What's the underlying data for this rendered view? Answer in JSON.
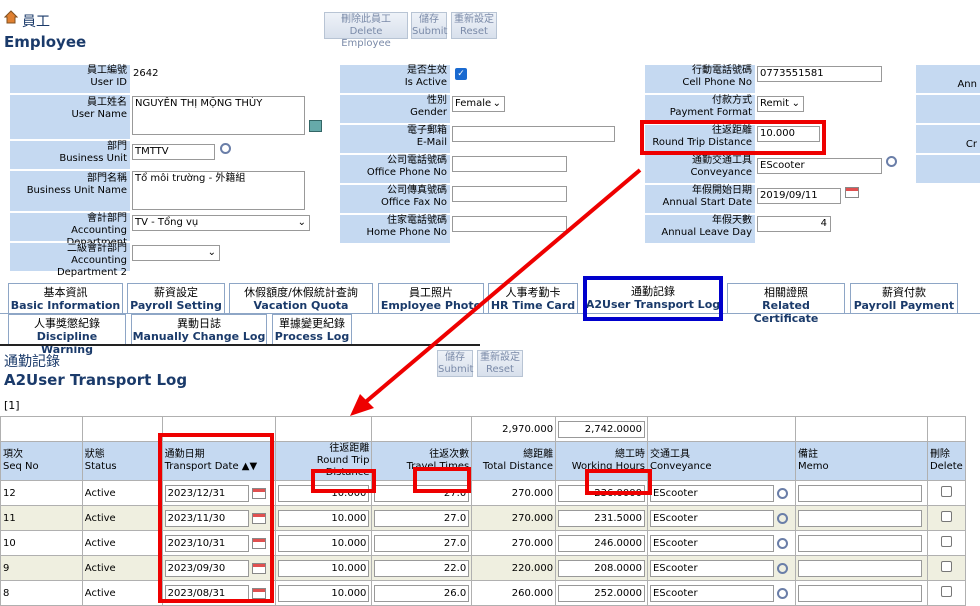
{
  "header": {
    "title_zh": "員工",
    "title_en": "Employee"
  },
  "toolbar": {
    "delete_zh": "刪除此員工",
    "delete_en": "Delete Employee",
    "save_zh": "儲存",
    "save_en": "Submit",
    "reset_zh": "重新設定",
    "reset_en": "Reset"
  },
  "form": {
    "user_id": {
      "zh": "員工編號",
      "en": "User ID",
      "value": "2642"
    },
    "user_name": {
      "zh": "員工姓名",
      "en": "User Name",
      "value": "NGUYỄN THỊ MỘNG THÙY"
    },
    "business_unit": {
      "zh": "部門",
      "en": "Business Unit",
      "value": "TMTTV"
    },
    "business_unit_name": {
      "zh": "部門名稱",
      "en": "Business Unit Name",
      "value": "Tổ môi trường - 外籍組"
    },
    "accounting_dept": {
      "zh": "會計部門",
      "en": "Accounting Department",
      "value": "TV - Tổng vụ"
    },
    "accounting_dept2": {
      "zh": "二級會計部門",
      "en": "Accounting Department 2",
      "value": ""
    },
    "is_active": {
      "zh": "是否生效",
      "en": "Is Active"
    },
    "gender": {
      "zh": "性別",
      "en": "Gender",
      "value": "Female"
    },
    "email": {
      "zh": "電子郵箱",
      "en": "E-Mail",
      "value": ""
    },
    "office_phone": {
      "zh": "公司電話號碼",
      "en": "Office Phone No",
      "value": ""
    },
    "office_fax": {
      "zh": "公司傳真號碼",
      "en": "Office Fax No",
      "value": ""
    },
    "home_phone": {
      "zh": "住家電話號碼",
      "en": "Home Phone No",
      "value": ""
    },
    "cell_phone": {
      "zh": "行動電話號碼",
      "en": "Cell Phone No",
      "value": "0773551581"
    },
    "payment_format": {
      "zh": "付款方式",
      "en": "Payment Format",
      "value": "Remit"
    },
    "round_trip": {
      "zh": "往返距離",
      "en": "Round Trip Distance",
      "value": "10.000"
    },
    "conveyance": {
      "zh": "通勤交通工具",
      "en": "Conveyance",
      "value": "EScooter"
    },
    "annual_start": {
      "zh": "年假開始日期",
      "en": "Annual Start Date",
      "value": "2019/09/11"
    },
    "annual_days": {
      "zh": "年假天數",
      "en": "Annual Leave Day",
      "value": "4"
    },
    "right_cut": [
      "Ann",
      "Cr"
    ]
  },
  "tabs": [
    {
      "zh": "基本資訊",
      "en": "Basic Information"
    },
    {
      "zh": "薪資設定",
      "en": "Payroll Setting"
    },
    {
      "zh": "休假額度/休假統計查詢",
      "en": "Vacation Quota Setting"
    },
    {
      "zh": "員工照片",
      "en": "Employee Photo"
    },
    {
      "zh": "人事考勤卡",
      "en": "HR Time Card"
    },
    {
      "zh": "通勤記錄",
      "en": "A2User Transport Log"
    },
    {
      "zh": "相關證照",
      "en": "Related Certificate"
    },
    {
      "zh": "薪資付款",
      "en": "Payroll Payment"
    },
    {
      "zh": "人事獎懲紀錄",
      "en": "Discipline Warning"
    },
    {
      "zh": "異動日誌",
      "en": "Manually Change Log"
    },
    {
      "zh": "單據變更紀錄",
      "en": "Process Log"
    }
  ],
  "section": {
    "title_zh": "通勤記錄",
    "title_en": "A2User Transport Log",
    "save_zh": "儲存",
    "save_en": "Submit",
    "reset_zh": "重新設定",
    "reset_en": "Reset",
    "pager": "[1]"
  },
  "log": {
    "total_distance": "2,970.000",
    "total_hours": "2,742.0000",
    "columns": [
      {
        "zh": "項次",
        "en": "Seq No"
      },
      {
        "zh": "狀態",
        "en": "Status"
      },
      {
        "zh": "通勤日期",
        "en": "Transport Date ▲▼"
      },
      {
        "zh": "往返距離",
        "en": "Round Trip Distance"
      },
      {
        "zh": "往返次數",
        "en": "Travel Times"
      },
      {
        "zh": "總距離",
        "en": "Total Distance"
      },
      {
        "zh": "總工時",
        "en": "Working Hours"
      },
      {
        "zh": "交通工具",
        "en": "Conveyance"
      },
      {
        "zh": "備註",
        "en": "Memo"
      },
      {
        "zh": "刪除",
        "en": "Delete"
      }
    ],
    "rows": [
      {
        "seq": "12",
        "status": "Active",
        "date": "2023/12/31",
        "distance": "10.000",
        "times": "27.0",
        "total": "270.000",
        "hours": "236.0000",
        "conveyance": "EScooter"
      },
      {
        "seq": "11",
        "status": "Active",
        "date": "2023/11/30",
        "distance": "10.000",
        "times": "27.0",
        "total": "270.000",
        "hours": "231.5000",
        "conveyance": "EScooter"
      },
      {
        "seq": "10",
        "status": "Active",
        "date": "2023/10/31",
        "distance": "10.000",
        "times": "27.0",
        "total": "270.000",
        "hours": "246.0000",
        "conveyance": "EScooter"
      },
      {
        "seq": "9",
        "status": "Active",
        "date": "2023/09/30",
        "distance": "10.000",
        "times": "22.0",
        "total": "220.000",
        "hours": "208.0000",
        "conveyance": "EScooter"
      },
      {
        "seq": "8",
        "status": "Active",
        "date": "2023/08/31",
        "distance": "10.000",
        "times": "26.0",
        "total": "260.000",
        "hours": "252.0000",
        "conveyance": "EScooter"
      }
    ]
  },
  "colors": {
    "label_bg": "#c5d9f1",
    "title": "#1a3a6a",
    "highlight": "#e00000",
    "tab_highlight": "#0000cc"
  }
}
